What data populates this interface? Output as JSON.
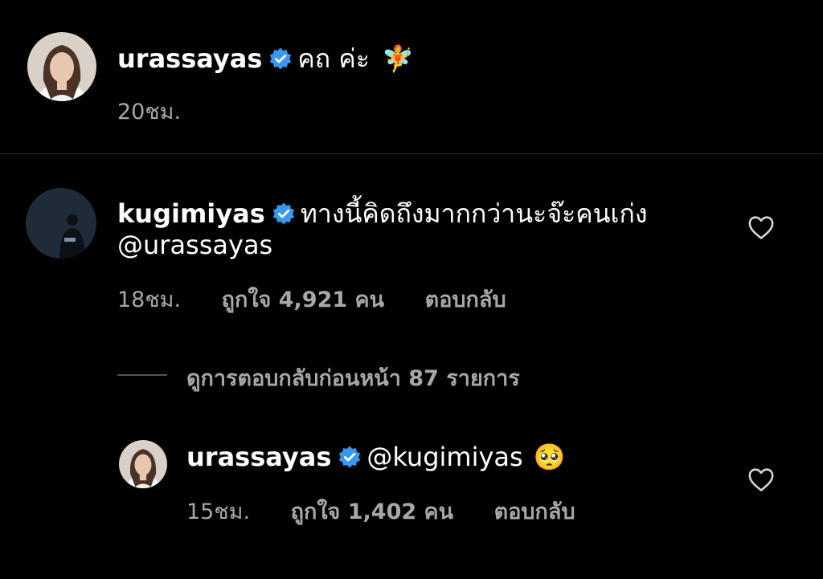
{
  "caption": {
    "username": "urassayas",
    "text": "คถ ค่ะ",
    "emoji": "🧚",
    "time": "20ชม."
  },
  "comment": {
    "username": "kugimiyas",
    "text_line1": "ทางนี้คิดถึงมากกว่านะจ๊ะคนเก่ง",
    "text_line2": "@urassayas",
    "time": "18ชม.",
    "likes": "ถูกใจ 4,921 คน",
    "reply_label": "ตอบกลับ"
  },
  "view_replies": "ดูการตอบกลับก่อนหน้า 87 รายการ",
  "reply": {
    "username": "urassayas",
    "text": "@kugimiyas",
    "emoji": "🥺",
    "time": "15ชม.",
    "likes": "ถูกใจ 1,402 คน",
    "reply_label": "ตอบกลับ"
  },
  "icons": {
    "verified": "verified-badge-icon",
    "like": "heart-outline-icon"
  },
  "colors": {
    "background": "#000000",
    "verified": "#3897f0",
    "secondary_text": "#a8a8a8"
  }
}
